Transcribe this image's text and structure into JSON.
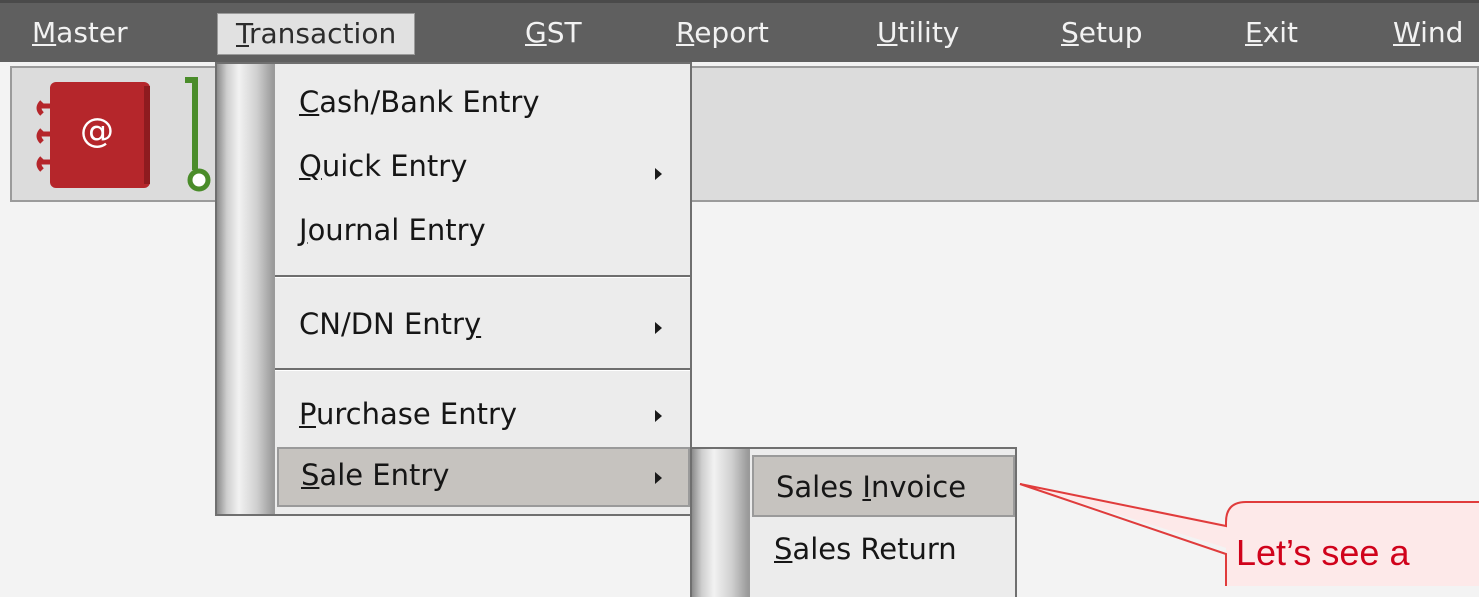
{
  "menubar": {
    "items": [
      {
        "pre": "",
        "acc": "M",
        "post": "aster"
      },
      {
        "pre": "",
        "acc": "T",
        "post": "ransaction"
      },
      {
        "pre": "",
        "acc": "G",
        "post": "ST"
      },
      {
        "pre": "",
        "acc": "R",
        "post": "eport"
      },
      {
        "pre": "",
        "acc": "U",
        "post": "tility"
      },
      {
        "pre": "",
        "acc": "S",
        "post": "etup"
      },
      {
        "pre": "",
        "acc": "E",
        "post": "xit"
      },
      {
        "pre": "",
        "acc": "W",
        "post": "ind"
      }
    ]
  },
  "transaction_menu": {
    "items": [
      {
        "pre": "",
        "acc": "C",
        "post": "ash/Bank Entry",
        "has_submenu": false
      },
      {
        "pre": "",
        "acc": "Q",
        "post": "uick Entry",
        "has_submenu": true
      },
      {
        "pre": "",
        "acc": "J",
        "post": "ournal Entry",
        "has_submenu": false
      },
      {
        "pre": "CN/DN Entr",
        "acc": "y",
        "post": "",
        "has_submenu": true
      },
      {
        "pre": "",
        "acc": "P",
        "post": "urchase Entry",
        "has_submenu": true
      },
      {
        "pre": "",
        "acc": "S",
        "post": "ale Entry",
        "has_submenu": true,
        "highlighted": true
      }
    ]
  },
  "sale_entry_submenu": {
    "items": [
      {
        "pre": "Sales ",
        "acc": "I",
        "post": "nvoice",
        "highlighted": true
      },
      {
        "pre": "",
        "acc": "S",
        "post": "ales Return"
      }
    ]
  },
  "toolbar": {
    "icons": [
      "address-book-icon",
      "connector-icon"
    ]
  },
  "callout": {
    "text": "Let’s see a",
    "border_color": "#e03c3c",
    "fill_color": "#fde9e9",
    "text_color": "#d0021b"
  },
  "colors": {
    "menubar_bg": "#5f5f5f",
    "menu_bg": "#ececec",
    "highlight": "#c6c3bf",
    "address_book_red": "#b5262b",
    "connector_green": "#4a8c2a"
  }
}
